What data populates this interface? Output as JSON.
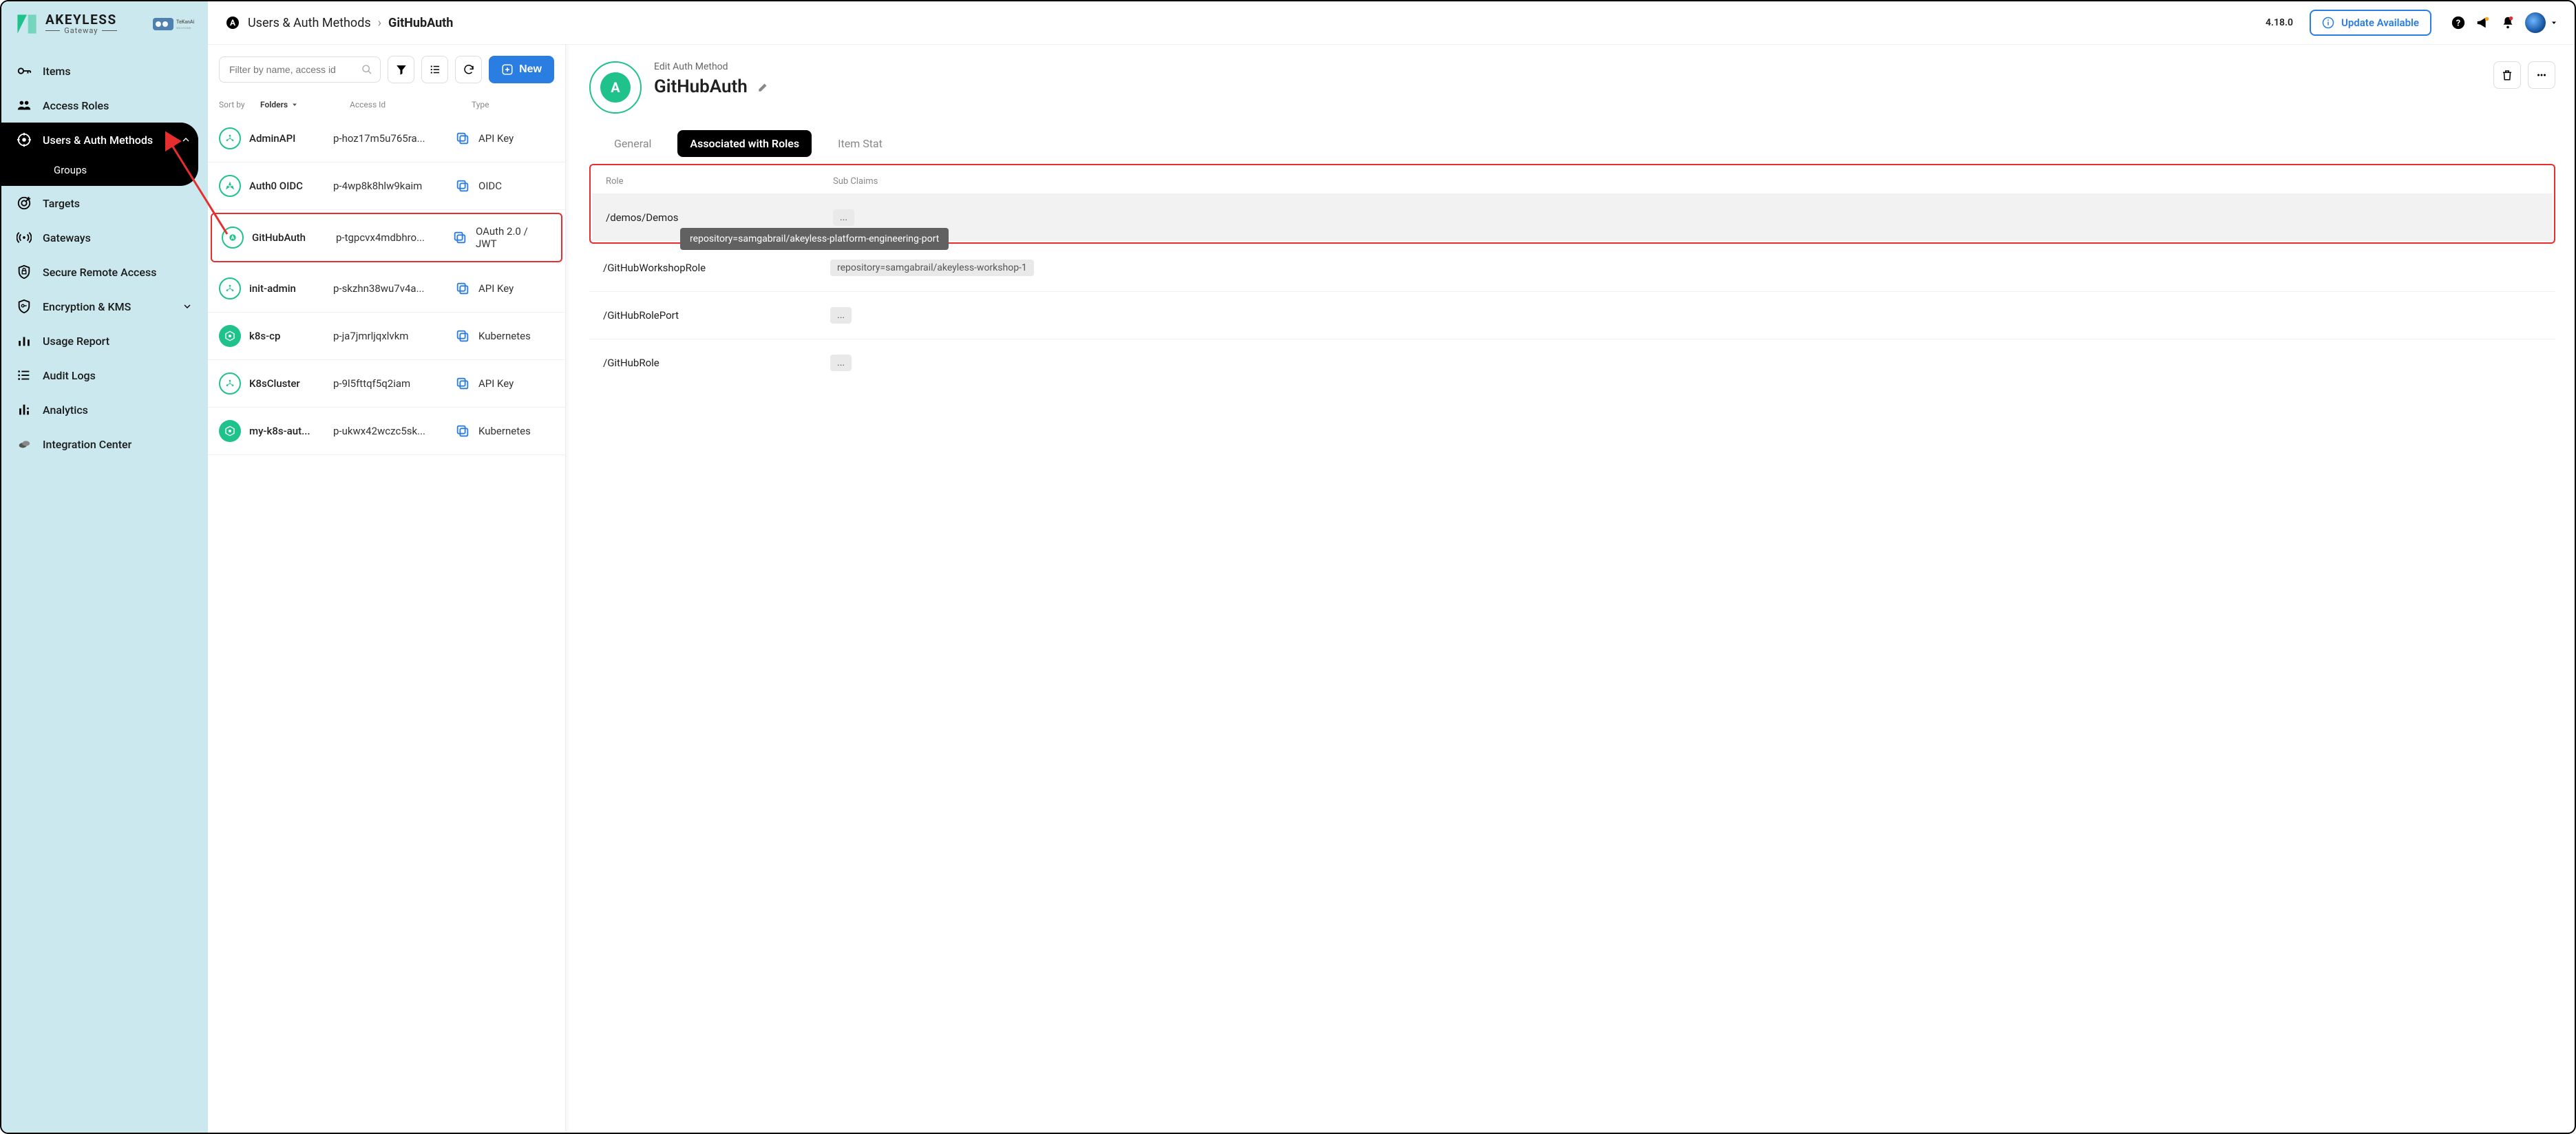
{
  "brand": {
    "name": "AKEYLESS",
    "sub": "Gateway"
  },
  "sidebar": {
    "items": [
      {
        "label": "Items"
      },
      {
        "label": "Access Roles"
      },
      {
        "label": "Users & Auth Methods"
      },
      {
        "label": "Targets"
      },
      {
        "label": "Gateways"
      },
      {
        "label": "Secure Remote Access"
      },
      {
        "label": "Encryption & KMS"
      },
      {
        "label": "Usage Report"
      },
      {
        "label": "Audit Logs"
      },
      {
        "label": "Analytics"
      },
      {
        "label": "Integration Center"
      }
    ],
    "sub": {
      "groups": "Groups"
    }
  },
  "breadcrumb": {
    "section": "Users & Auth Methods",
    "current": "GitHubAuth"
  },
  "topbar": {
    "version": "4.18.0",
    "update": "Update Available"
  },
  "list": {
    "filter_placeholder": "Filter by name, access id",
    "new_label": "New",
    "header": {
      "sort": "Sort by",
      "folders": "Folders",
      "access": "Access Id",
      "type": "Type"
    },
    "rows": [
      {
        "name": "AdminAPI",
        "access": "p-hoz17m5u765ra...",
        "type": "API Key"
      },
      {
        "name": "Auth0 OIDC",
        "access": "p-4wp8k8hlw9kaim",
        "type": "OIDC"
      },
      {
        "name": "GitHubAuth",
        "access": "p-tgpcvx4mdbhro...",
        "type": "OAuth 2.0 / JWT"
      },
      {
        "name": "init-admin",
        "access": "p-skzhn38wu7v4a...",
        "type": "API Key"
      },
      {
        "name": "k8s-cp",
        "access": "p-ja7jmrljqxlvkm",
        "type": "Kubernetes"
      },
      {
        "name": "K8sCluster",
        "access": "p-9l5fttqf5q2iam",
        "type": "API Key"
      },
      {
        "name": "my-k8s-aut...",
        "access": "p-ukwx42wczc5sk...",
        "type": "Kubernetes"
      }
    ]
  },
  "detail": {
    "sub": "Edit Auth Method",
    "title": "GitHubAuth",
    "avatar_letter": "A",
    "tabs": [
      {
        "label": "General"
      },
      {
        "label": "Associated with Roles"
      },
      {
        "label": "Item Stat"
      }
    ],
    "roles_header": {
      "role": "Role",
      "sub": "Sub Claims"
    },
    "roles": [
      {
        "role": "/demos/Demos",
        "sub": "..."
      },
      {
        "role": "/GitHubWorkshopRole",
        "sub": "repository=samgabrail/akeyless-workshop-1"
      },
      {
        "role": "/GitHubRolePort",
        "sub": "..."
      },
      {
        "role": "/GitHubRole",
        "sub": "..."
      }
    ],
    "tooltip": "repository=samgabrail/akeyless-platform-engineering-port"
  }
}
